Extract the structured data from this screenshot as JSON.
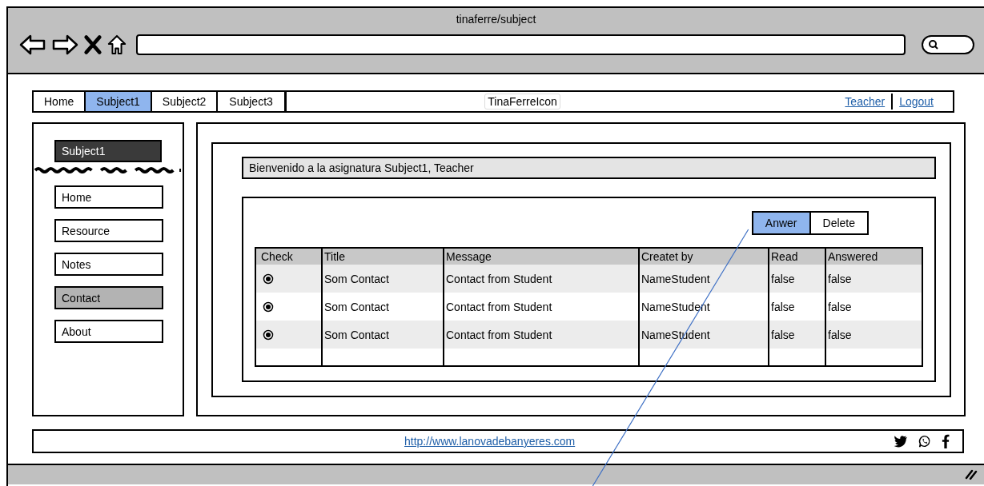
{
  "browser": {
    "title": "tinaferre/subject"
  },
  "nav": {
    "tabs": [
      {
        "label": "Home",
        "selected": false
      },
      {
        "label": "Subject1",
        "selected": true
      },
      {
        "label": "Subject2",
        "selected": false
      },
      {
        "label": "Subject3",
        "selected": false
      }
    ],
    "logo": "TinaFerreIcon",
    "links": [
      "Teacher",
      "Logout"
    ]
  },
  "sidebar": {
    "heading": "Subject1",
    "items": [
      {
        "label": "Home",
        "selected": false
      },
      {
        "label": "Resource",
        "selected": false
      },
      {
        "label": "Notes",
        "selected": false
      },
      {
        "label": "Contact",
        "selected": true
      },
      {
        "label": "About",
        "selected": false
      }
    ]
  },
  "welcome": "Bienvenido a la asignatura Subject1, Teacher",
  "actions": [
    {
      "label": "Anwer",
      "selected": true
    },
    {
      "label": "Delete",
      "selected": false
    }
  ],
  "table": {
    "columns": [
      "Check",
      "Title",
      "Message",
      "Createt by",
      "Read",
      "Answered"
    ],
    "rows": [
      {
        "checked": true,
        "cells": [
          "",
          "Som Contact",
          "Contact from Student",
          "NameStudent",
          "false",
          "false"
        ]
      },
      {
        "checked": true,
        "cells": [
          "",
          "Som Contact",
          "Contact from Student",
          "NameStudent",
          "false",
          "false"
        ]
      },
      {
        "checked": true,
        "cells": [
          "",
          "Som Contact",
          "Contact from Student",
          "NameStudent",
          "false",
          "false"
        ]
      }
    ]
  },
  "footer": {
    "link": "http://www.lanovadebanyeres.com"
  }
}
